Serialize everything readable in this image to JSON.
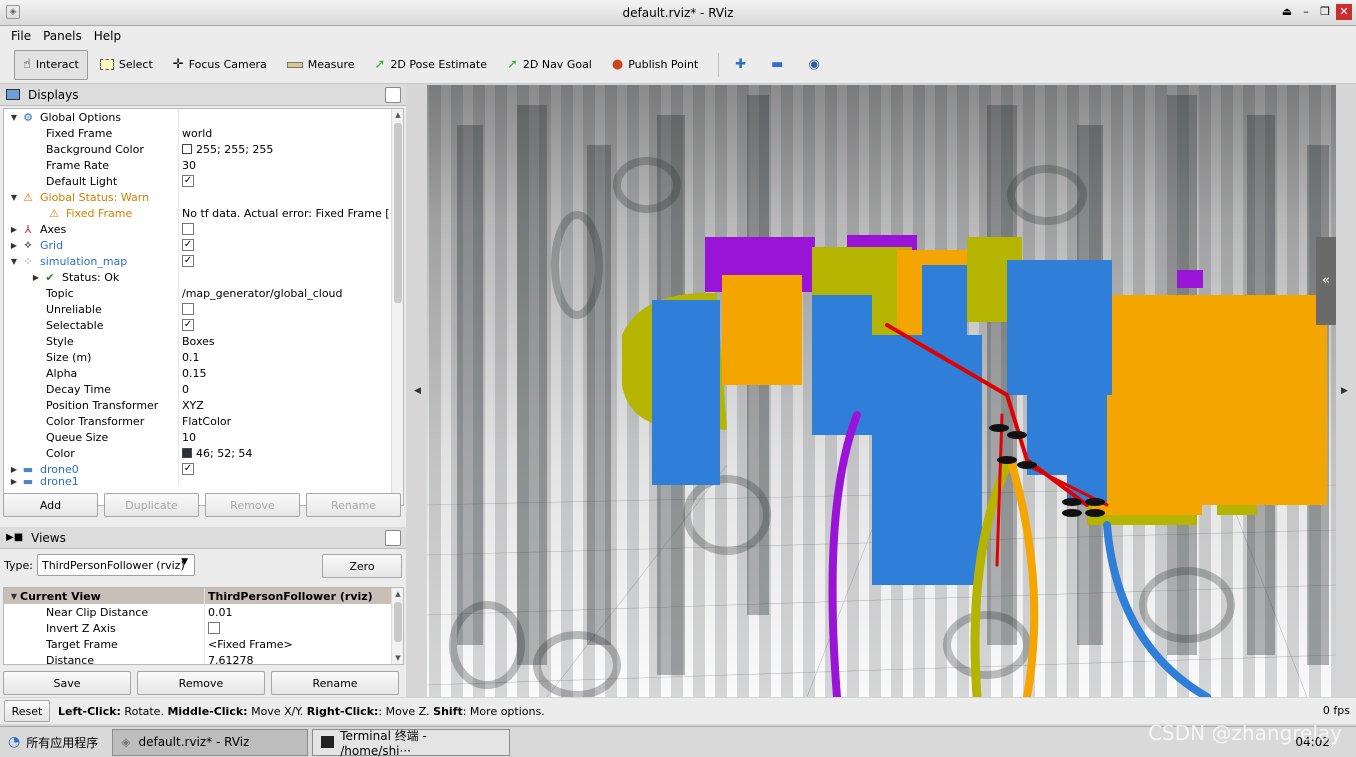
{
  "window": {
    "title": "default.rviz* - RViz"
  },
  "menu": [
    "File",
    "Panels",
    "Help"
  ],
  "toolbar": {
    "interact": "Interact",
    "select": "Select",
    "focus_camera": "Focus Camera",
    "measure": "Measure",
    "pose_estimate": "2D Pose Estimate",
    "nav_goal": "2D Nav Goal",
    "publish_point": "Publish Point"
  },
  "displays": {
    "title": "Displays",
    "rows": [
      {
        "label": "Global Options",
        "value": ""
      },
      {
        "label": "Fixed Frame",
        "value": "world"
      },
      {
        "label": "Background Color",
        "value": "255; 255; 255"
      },
      {
        "label": "Frame Rate",
        "value": "30"
      },
      {
        "label": "Default Light",
        "value": "✓"
      },
      {
        "label": "Global Status: Warn",
        "value": ""
      },
      {
        "label": "Fixed Frame",
        "value": "No tf data.  Actual error: Fixed Frame [···"
      },
      {
        "label": "Axes",
        "value": ""
      },
      {
        "label": "Grid",
        "value": "✓"
      },
      {
        "label": "simulation_map",
        "value": "✓"
      },
      {
        "label": "Status: Ok",
        "value": ""
      },
      {
        "label": "Topic",
        "value": "/map_generator/global_cloud"
      },
      {
        "label": "Unreliable",
        "value": ""
      },
      {
        "label": "Selectable",
        "value": "✓"
      },
      {
        "label": "Style",
        "value": "Boxes"
      },
      {
        "label": "Size (m)",
        "value": "0.1"
      },
      {
        "label": "Alpha",
        "value": "0.15"
      },
      {
        "label": "Decay Time",
        "value": "0"
      },
      {
        "label": "Position Transformer",
        "value": "XYZ"
      },
      {
        "label": "Color Transformer",
        "value": "FlatColor"
      },
      {
        "label": "Queue Size",
        "value": "10"
      },
      {
        "label": "Color",
        "value": "46; 52; 54"
      },
      {
        "label": "drone0",
        "value": "✓"
      },
      {
        "label": "drone1",
        "value": ""
      }
    ],
    "buttons": {
      "add": "Add",
      "duplicate": "Duplicate",
      "remove": "Remove",
      "rename": "Rename"
    }
  },
  "views": {
    "title": "Views",
    "type_label": "Type:",
    "type_value": "ThirdPersonFollower (rviz)",
    "zero": "Zero",
    "rows": [
      {
        "label": "Current View",
        "value": "ThirdPersonFollower (rviz)"
      },
      {
        "label": "Near Clip Distance",
        "value": "0.01"
      },
      {
        "label": "Invert Z Axis",
        "value": ""
      },
      {
        "label": "Target Frame",
        "value": "<Fixed Frame>"
      },
      {
        "label": "Distance",
        "value": "7.61278"
      }
    ],
    "buttons": {
      "save": "Save",
      "remove": "Remove",
      "rename": "Rename"
    }
  },
  "status": {
    "reset": "Reset",
    "hint_1": "Left-Click:",
    "hint_2": " Rotate. ",
    "hint_3": "Middle-Click:",
    "hint_4": " Move X/Y. ",
    "hint_5": "Right-Click:",
    "hint_6": ": Move Z. ",
    "hint_7": "Shift",
    "hint_8": ": More options.",
    "fps": "0 fps"
  },
  "taskbar": {
    "start": "所有应用程序",
    "task1": "default.rviz* - RViz",
    "task2": "Terminal 终端 - /home/shi···",
    "clock": "04:02"
  },
  "watermark": "CSDN @zhangrelay",
  "colors": {
    "blue_obj": "#2f7fd8",
    "yellow_obj": "#b5b400",
    "orange_obj": "#f5a500",
    "purple_obj": "#9a14d8",
    "path_red": "#e00000"
  }
}
